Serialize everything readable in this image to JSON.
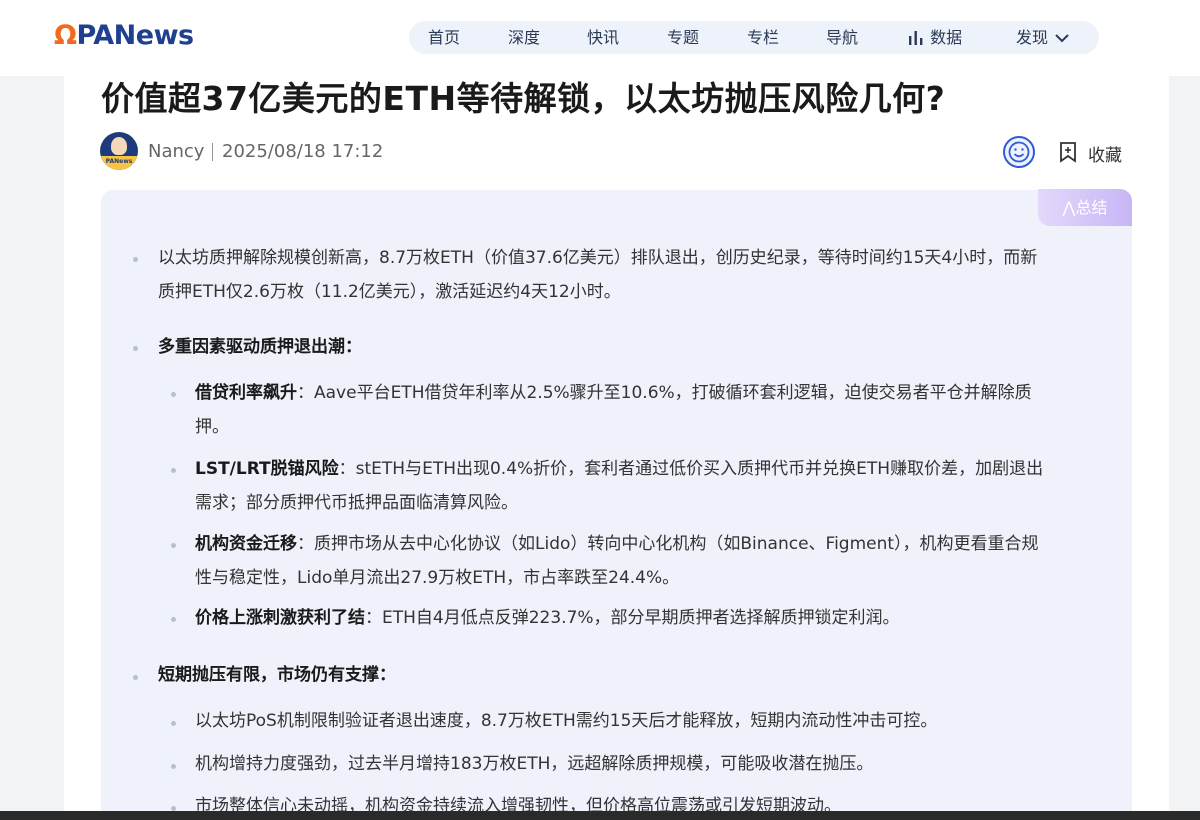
{
  "header": {
    "logo": "PANews",
    "nav": [
      {
        "label": "首页"
      },
      {
        "label": "深度"
      },
      {
        "label": "快讯"
      },
      {
        "label": "专题"
      },
      {
        "label": "专栏"
      },
      {
        "label": "导航"
      },
      {
        "label": "数据",
        "icon": "bar-chart-icon"
      },
      {
        "label": "发现",
        "icon": "chevron-down-icon"
      }
    ]
  },
  "article": {
    "title": "价值超37亿美元的ETH等待解锁，以太坊抛压风险几何?",
    "author": "Nancy",
    "date": "2025/08/18 17:12",
    "favorite_label": "收藏",
    "avatar_text": "PANews"
  },
  "summary": {
    "badge": "总结",
    "p1_line1": "以太坊质押解除规模创新高，8.7万枚ETH（价值37.6亿美元）排队退出，创历史纪录，等待时间约15天4小时，而新",
    "p1_line2": "质押ETH仅2.6万枚（11.2亿美元），激活延迟约4天12小时。",
    "section1_title": "多重因素驱动质押退出潮",
    "section1_items": [
      {
        "bold": "借贷利率飙升",
        "line1": "：Aave平台ETH借贷年利率从2.5%骤升至10.6%，打破循环套利逻辑，迫使交易者平仓并解除质",
        "line2": "押。"
      },
      {
        "bold": "LST/LRT脱锚风险",
        "line1": "：stETH与ETH出现0.4%折价，套利者通过低价买入质押代币并兑换ETH赚取价差，加剧退出",
        "line2": "需求；部分质押代币抵押品面临清算风险。"
      },
      {
        "bold": "机构资金迁移",
        "line1": "：质押市场从去中心化协议（如Lido）转向中心化机构（如Binance、Figment），机构更看重合规",
        "line2": "性与稳定性，Lido单月流出27.9万枚ETH，市占率跌至24.4%。"
      },
      {
        "bold": "价格上涨刺激获利了结",
        "line1": "：ETH自4月低点反弹223.7%，部分早期质押者选择解质押锁定利润。",
        "line2": ""
      }
    ],
    "section2_title": "短期抛压有限，市场仍有支撑",
    "section2_items": [
      "以太坊PoS机制限制验证者退出速度，8.7万枚ETH需约15天后才能释放，短期内流动性冲击可控。",
      "机构增持力度强劲，过去半月增持183万枚ETH，远超解除质押规模，可能吸收潜在抛压。",
      "市场整体信心未动摇，机构资金持续流入增强韧性，但价格高位震荡或引发短期波动。"
    ]
  },
  "colors": {
    "brand_blue": "#1f3f8f",
    "brand_orange": "#f26a1b",
    "summary_bg": "#eff2fb",
    "badge_gradient_end": "#c7b6f6"
  }
}
